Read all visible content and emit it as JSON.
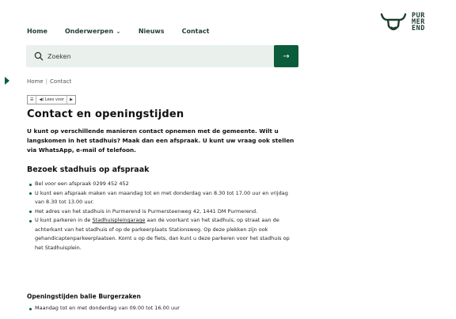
{
  "nav": {
    "home": "Home",
    "onderwerpen": "Onderwerpen",
    "nieuws": "Nieuws",
    "contact": "Contact"
  },
  "logo": {
    "line1": "PUR",
    "line2": "MER",
    "line3": "END",
    "icon": "bull-head-icon"
  },
  "search": {
    "placeholder": "Zoeken",
    "button_icon": "arrow-right-icon"
  },
  "breadcrumb": {
    "home": "Home",
    "separator": "|",
    "current": "Contact"
  },
  "reader": {
    "menu_icon": "menu-icon",
    "label": "Lees voor",
    "play_icon": "play-icon"
  },
  "page": {
    "title": "Contact en openingstijden",
    "intro": "U kunt op verschillende manieren contact opnemen met de gemeente. Wilt u langskomen in het stadhuis? Maak dan een afspraak. U kunt uw vraag ook stellen via WhatsApp, e-mail of telefoon."
  },
  "visit": {
    "heading": "Bezoek stadhuis op afspraak",
    "items": [
      "Bel voor een afspraak 0299 452 452",
      "U kunt een afspraak maken van maandag tot en met donderdag van 8.30 tot 17.00 uur en vrijdag van 8.30 tot 13.00 uur.",
      "Het adres van het stadhuis in Purmerend is Purmersteenweg 42, 1441 DM Purmerend.",
      "U kunt parkeren in de",
      "Stadhuispleingarage",
      "aan de voorkant van het stadhuis, op straat aan de achterkant van het stadhuis of op de parkeerplaats Stationsweg. Op deze plekken zijn ook gehandicaptenparkeerplaatsen. Komt u op de fiets, dan kunt u deze parkeren voor het stadhuis op het Stadhuisplein."
    ]
  },
  "hours": {
    "heading": "Openingstijden balie Burgerzaken",
    "items": [
      "Maandag tot en met donderdag van 09.00 tot 16.00 uur"
    ]
  },
  "colors": {
    "brand": "#0a5c3a",
    "search_bg": "#eaf0ec",
    "nav_text": "#1f3d2e"
  }
}
